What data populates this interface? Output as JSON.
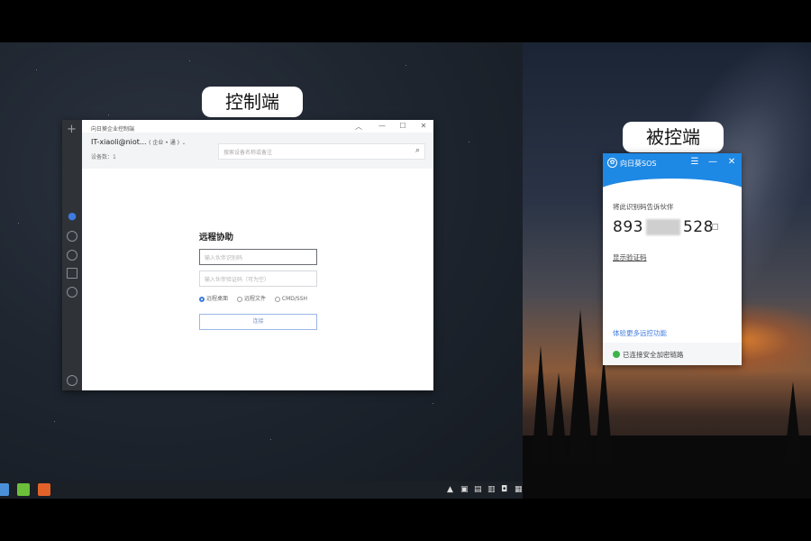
{
  "labels": {
    "controller": "控制端",
    "controlled": "被控端"
  },
  "controller": {
    "title": "向日葵企业控制端",
    "window_controls": [
      "︿",
      "—",
      "☐",
      "✕"
    ],
    "user": "IT-xiaoli@niot...",
    "user_tag": "( 企业 • 通 )",
    "devices": "设备数：1",
    "search_placeholder": "搜索设备名称或备注",
    "form_title": "远程协助",
    "code_placeholder": "输入伙伴识别码",
    "verify_placeholder": "输入伙伴验证码（可为空）",
    "modes": [
      "远程桌面",
      "远程文件",
      "CMD/SSH"
    ],
    "selected_mode": "远程桌面",
    "connect_label": "连接",
    "sidebar_icons": [
      "plus-icon",
      "devices-icon",
      "history-icon",
      "remote-icon",
      "grid-icon",
      "box-icon",
      "settings-icon"
    ]
  },
  "controlled": {
    "title": "向日葵SOS",
    "window_controls": [
      "☰",
      "—",
      "✕"
    ],
    "prompt": "将此识别码告诉伙伴",
    "code_start": "893",
    "code_end": "528",
    "show_verify_link": "显示验证码",
    "more_link": "体验更多远控功能",
    "status": "已连接安全加密链路"
  },
  "colors": {
    "accent": "#1e88e5",
    "status_ok": "#3cb34a",
    "sidebar": "#2f3338"
  }
}
